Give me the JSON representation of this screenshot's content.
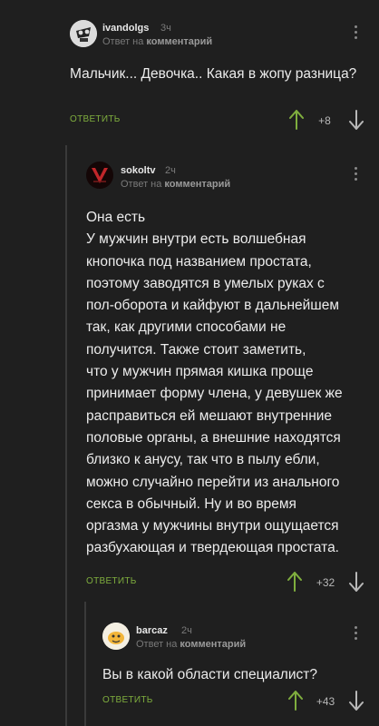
{
  "comments": [
    {
      "author": "ivandolgs",
      "time": "3ч",
      "reply_prefix": "Ответ на",
      "reply_target": "комментарий",
      "text": "Мальчик... Девочка.. Какая в жопу разница?",
      "reply_label": "ОТВЕТИТЬ",
      "rating": "+8",
      "avatar_icon": "skull-avatar-icon"
    },
    {
      "author": "sokoltv",
      "time": "2ч",
      "reply_prefix": "Ответ на",
      "reply_target": "комментарий",
      "text": "Она есть\nУ мужчин внутри есть волшебная\nкнопочка под названием простата,\nпоэтому заводятся в умелых руках с\nпол-оборота и кайфуют в дальнейшем\nтак, как другими способами не\nполучится. Также стоит заметить,\nчто у мужчин прямая кишка проще\nпринимает форму члена, у девушек же\nрасправиться ей мешают внутренние\nполовые органы, а внешние находятся\nблизко к анусу, так что в пылу ебли,\nможно случайно перейти из анального\nсекса в обычный. Ну и во время\nоргазма у мужчины внутри ощущается\nразбухающая и твердеющая простата.",
      "reply_label": "ОТВЕТИТЬ",
      "rating": "+32",
      "avatar_icon": "red-v-avatar-icon"
    },
    {
      "author": "barcaz",
      "time": "2ч",
      "reply_prefix": "Ответ на",
      "reply_target": "комментарий",
      "text": "Вы в какой области специалист?",
      "reply_label": "ОТВЕТИТЬ",
      "rating": "+43",
      "avatar_icon": "cartoon-avatar-icon"
    }
  ],
  "colors": {
    "background": "#1f1f1f",
    "reply_green": "#7fae3e",
    "upvote_green": "#7fae3e",
    "downvote_gray": "#b8b8b8"
  }
}
